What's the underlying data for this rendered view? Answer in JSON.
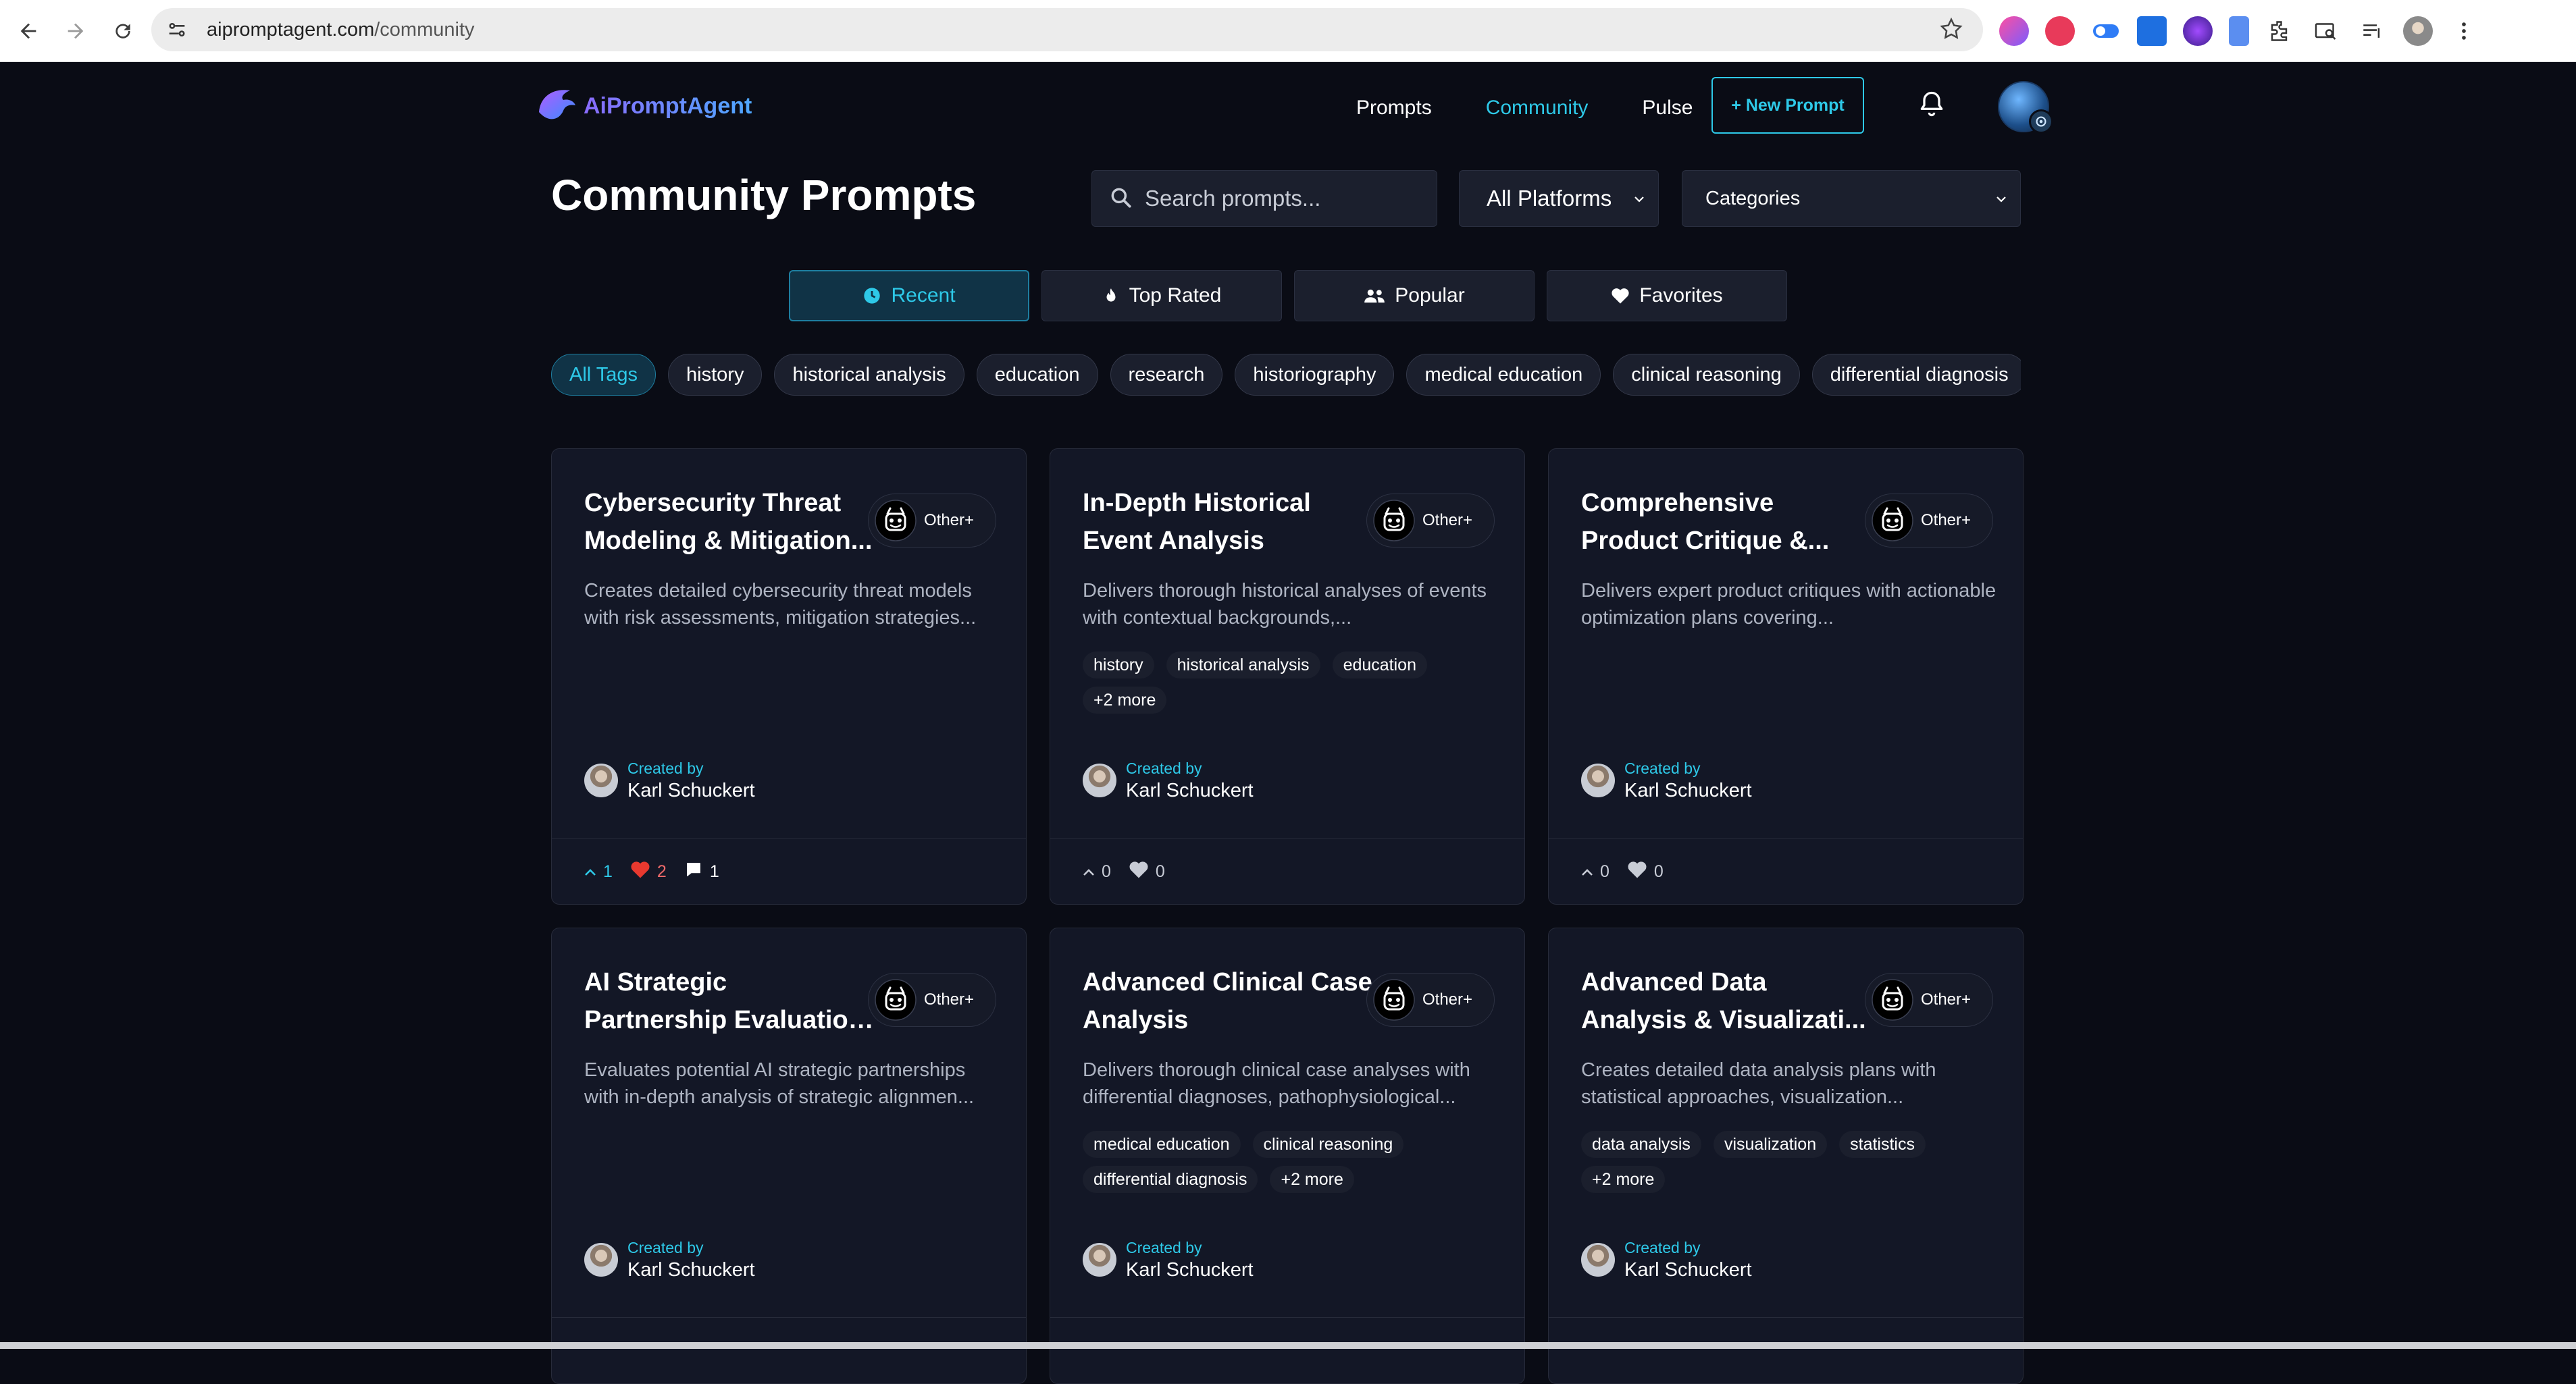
{
  "browser": {
    "url_host": "aipromptagent.com",
    "url_path": "/community"
  },
  "brand": {
    "name": "AiPromptAgent"
  },
  "nav": {
    "items": [
      {
        "label": "Prompts",
        "active": false
      },
      {
        "label": "Community",
        "active": true
      },
      {
        "label": "Pulse",
        "active": false
      }
    ],
    "new_prompt": "+ New Prompt"
  },
  "page": {
    "title": "Community Prompts",
    "search_placeholder": "Search prompts...",
    "platform_select": "All Platforms",
    "category_select": "Categories"
  },
  "filters": [
    {
      "label": "Recent",
      "icon": "clock-icon",
      "active": true
    },
    {
      "label": "Top Rated",
      "icon": "fire-icon",
      "active": false
    },
    {
      "label": "Popular",
      "icon": "users-icon",
      "active": false
    },
    {
      "label": "Favorites",
      "icon": "heart-icon",
      "active": false
    }
  ],
  "tags": [
    "All Tags",
    "history",
    "historical analysis",
    "education",
    "research",
    "historiography",
    "medical education",
    "clinical reasoning",
    "differential diagnosis"
  ],
  "cards": [
    {
      "title": "Cybersecurity Threat Modeling & Mitigation...",
      "platform": "Other+",
      "description": "Creates detailed cybersecurity threat models with risk assessments, mitigation strategies...",
      "tags": [],
      "created_by_label": "Created by",
      "creator": "Karl Schuckert",
      "upvotes": "1",
      "likes": "2",
      "comments": "1"
    },
    {
      "title": "In-Depth Historical Event Analysis",
      "platform": "Other+",
      "description": "Delivers thorough historical analyses of events with contextual backgrounds,...",
      "tags": [
        "history",
        "historical analysis",
        "education",
        "+2 more"
      ],
      "created_by_label": "Created by",
      "creator": "Karl Schuckert",
      "upvotes": "0",
      "likes": "0",
      "comments": ""
    },
    {
      "title": "Comprehensive Product Critique &...",
      "platform": "Other+",
      "description": "Delivers expert product critiques with actionable optimization plans covering...",
      "tags": [],
      "created_by_label": "Created by",
      "creator": "Karl Schuckert",
      "upvotes": "0",
      "likes": "0",
      "comments": ""
    },
    {
      "title": "AI Strategic Partnership Evaluation Framework",
      "platform": "Other+",
      "description": "Evaluates potential AI strategic partnerships with in-depth analysis of strategic alignmen...",
      "tags": [],
      "created_by_label": "Created by",
      "creator": "Karl Schuckert",
      "upvotes": "",
      "likes": "",
      "comments": ""
    },
    {
      "title": "Advanced Clinical Case Analysis",
      "platform": "Other+",
      "description": "Delivers thorough clinical case analyses with differential diagnoses, pathophysiological...",
      "tags": [
        "medical education",
        "clinical reasoning",
        "differential diagnosis",
        "+2 more"
      ],
      "created_by_label": "Created by",
      "creator": "Karl Schuckert",
      "upvotes": "",
      "likes": "",
      "comments": ""
    },
    {
      "title": "Advanced Data Analysis & Visualizati...",
      "platform": "Other+",
      "description": "Creates detailed data analysis plans with statistical approaches, visualization...",
      "tags": [
        "data analysis",
        "visualization",
        "statistics",
        "+2 more"
      ],
      "created_by_label": "Created by",
      "creator": "Karl Schuckert",
      "upvotes": "",
      "likes": "",
      "comments": ""
    }
  ],
  "colors": {
    "background": "#0a0c15",
    "card": "#131726",
    "accent": "#2ec9e8",
    "heart": "#f06a6a"
  }
}
